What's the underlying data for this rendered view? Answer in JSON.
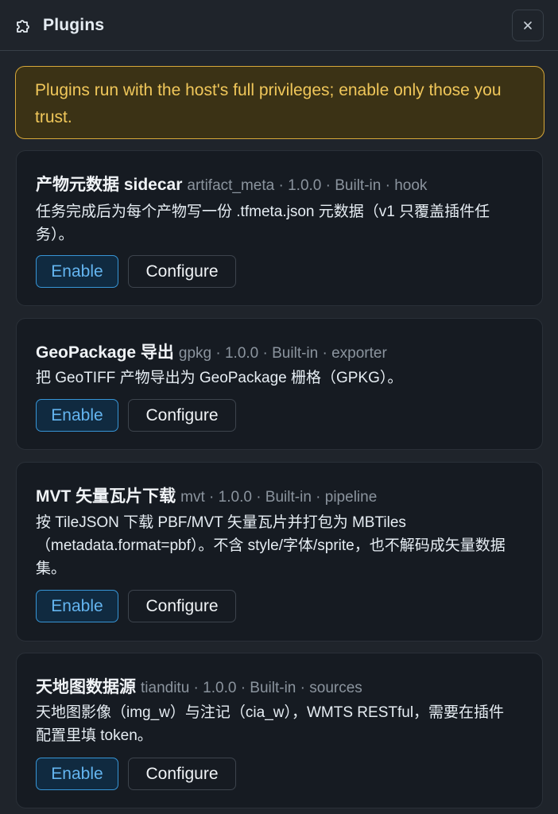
{
  "dialog": {
    "title": "Plugins",
    "icons": {
      "header": "puzzle-icon",
      "close": "close-icon"
    }
  },
  "warning": {
    "text": "Plugins run with the host's full privileges; enable only those you trust."
  },
  "plugins": [
    {
      "name": "产物元数据 sidecar",
      "meta": "artifact_meta · 1.0.0 · Built-in · hook",
      "description": "任务完成后为每个产物写一份 .tfmeta.json 元数据（v1 只覆盖插件任务）。",
      "enable_label": "Enable",
      "configure_label": "Configure"
    },
    {
      "name": "GeoPackage 导出",
      "meta": "gpkg · 1.0.0 · Built-in · exporter",
      "description": "把 GeoTIFF 产物导出为 GeoPackage 栅格（GPKG）。",
      "enable_label": "Enable",
      "configure_label": "Configure"
    },
    {
      "name": "MVT 矢量瓦片下载",
      "meta": "mvt · 1.0.0 · Built-in · pipeline",
      "description": "按 TileJSON 下载 PBF/MVT 矢量瓦片并打包为 MBTiles（metadata.format=pbf）。不含 style/字体/sprite，也不解码成矢量数据集。",
      "enable_label": "Enable",
      "configure_label": "Configure"
    },
    {
      "name": "天地图数据源",
      "meta": "tianditu · 1.0.0 · Built-in · sources",
      "description": "天地图影像（img_w）与注记（cia_w），WMTS RESTful，需要在插件配置里填 token。",
      "enable_label": "Enable",
      "configure_label": "Configure"
    }
  ],
  "colors": {
    "background": "#1f242b",
    "card": "#161b22",
    "warning_bg": "#3b3215",
    "warning_border": "#d7a83a",
    "warning_text": "#f0c75a",
    "accent": "#3795d6"
  }
}
